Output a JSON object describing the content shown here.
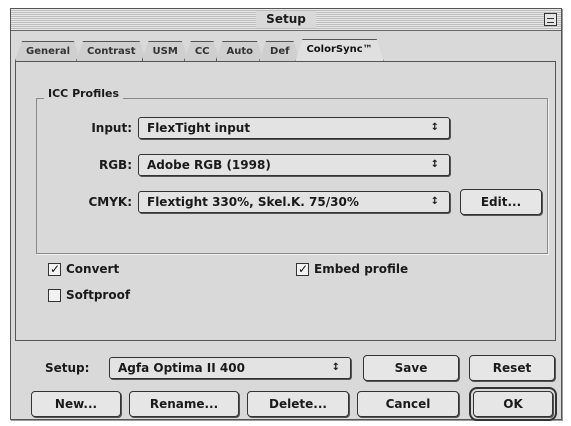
{
  "window": {
    "title": "Setup"
  },
  "tabs": [
    {
      "label": "General",
      "active": false
    },
    {
      "label": "Contrast",
      "active": false
    },
    {
      "label": "USM",
      "active": false
    },
    {
      "label": "CC",
      "active": false
    },
    {
      "label": "Auto",
      "active": false
    },
    {
      "label": "Def",
      "active": false
    },
    {
      "label": "ColorSync™",
      "active": true
    }
  ],
  "icc_profiles": {
    "title": "ICC Profiles",
    "input": {
      "label": "Input:",
      "value": "FlexTight input"
    },
    "rgb": {
      "label": "RGB:",
      "value": "Adobe RGB (1998)"
    },
    "cmyk": {
      "label": "CMYK:",
      "value": "Flextight 330%, Skel.K. 75/30%"
    },
    "edit_label": "Edit..."
  },
  "options": {
    "convert": {
      "label": "Convert",
      "checked": true
    },
    "softproof": {
      "label": "Softproof",
      "checked": false
    },
    "embed_profile": {
      "label": "Embed profile",
      "checked": true
    }
  },
  "footer": {
    "setup_label": "Setup:",
    "setup_value": "Agfa Optima II 400",
    "save_label": "Save",
    "reset_label": "Reset",
    "new_label": "New...",
    "rename_label": "Rename...",
    "delete_label": "Delete...",
    "cancel_label": "Cancel",
    "ok_label": "OK"
  },
  "icons": {
    "popup_arrows": "↕",
    "checkmark": "checkmark-icon"
  },
  "colors": {
    "window_bg": "#d9d9d9",
    "border": "#333333"
  }
}
